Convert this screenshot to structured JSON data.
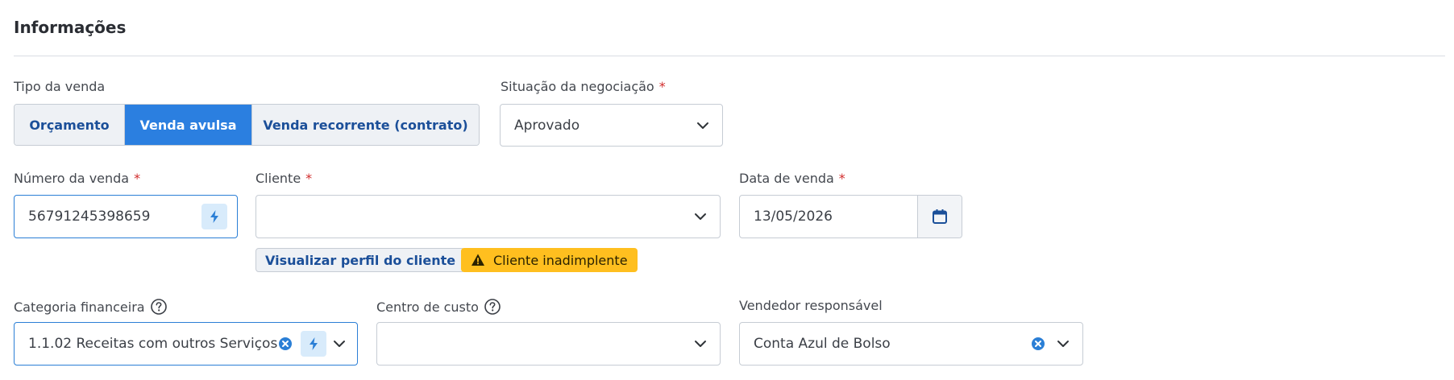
{
  "section": {
    "title": "Informações"
  },
  "sale_type": {
    "label": "Tipo da venda",
    "options": [
      "Orçamento",
      "Venda avulsa",
      "Venda recorrente (contrato)"
    ],
    "selected": "Venda avulsa"
  },
  "negotiation_status": {
    "label": "Situação da negociação",
    "required_mark": "*",
    "value": "Aprovado"
  },
  "sale_number": {
    "label": "Número da venda",
    "required_mark": "*",
    "value": "56791245398659"
  },
  "client": {
    "label": "Cliente",
    "required_mark": "*",
    "value": "",
    "profile_button": "Visualizar perfil do cliente",
    "warning_badge": "Cliente inadimplente"
  },
  "sale_date": {
    "label": "Data de venda",
    "required_mark": "*",
    "value": "13/05/2026"
  },
  "financial_category": {
    "label": "Categoria financeira",
    "value": "1.1.02 Receitas com outros Serviços"
  },
  "cost_center": {
    "label": "Centro de custo",
    "value": ""
  },
  "salesperson": {
    "label": "Vendedor responsável",
    "value": "Conta Azul de Bolso"
  },
  "colors": {
    "accent": "#2b7fe0",
    "warning": "#ffbf1f",
    "required": "#d12b2b",
    "link": "#1b4f99"
  },
  "icons": [
    "chevron-down-icon",
    "lightning-icon",
    "calendar-icon",
    "help-icon",
    "clear-icon",
    "warning-icon"
  ]
}
